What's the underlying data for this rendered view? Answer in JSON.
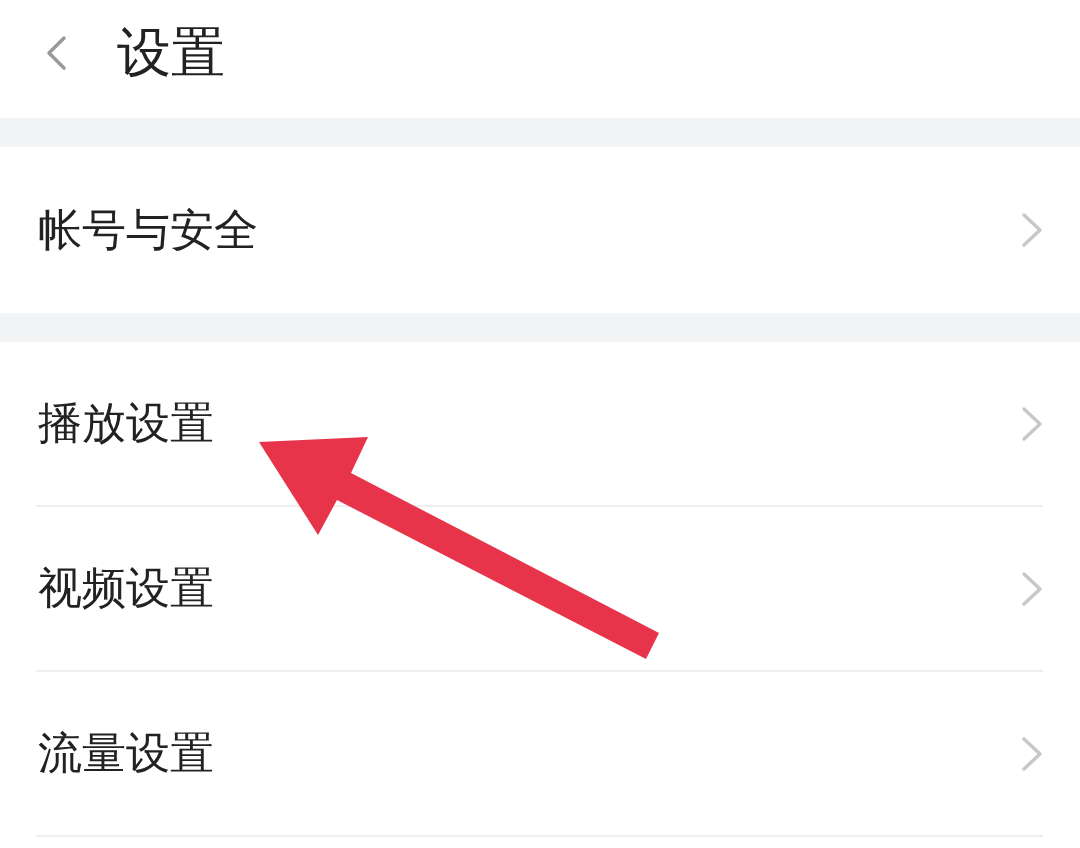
{
  "header": {
    "title": "设置"
  },
  "groups": [
    {
      "items": [
        {
          "label": "帐号与安全"
        }
      ]
    },
    {
      "items": [
        {
          "label": "播放设置"
        },
        {
          "label": "视频设置"
        },
        {
          "label": "流量设置"
        }
      ]
    }
  ]
}
